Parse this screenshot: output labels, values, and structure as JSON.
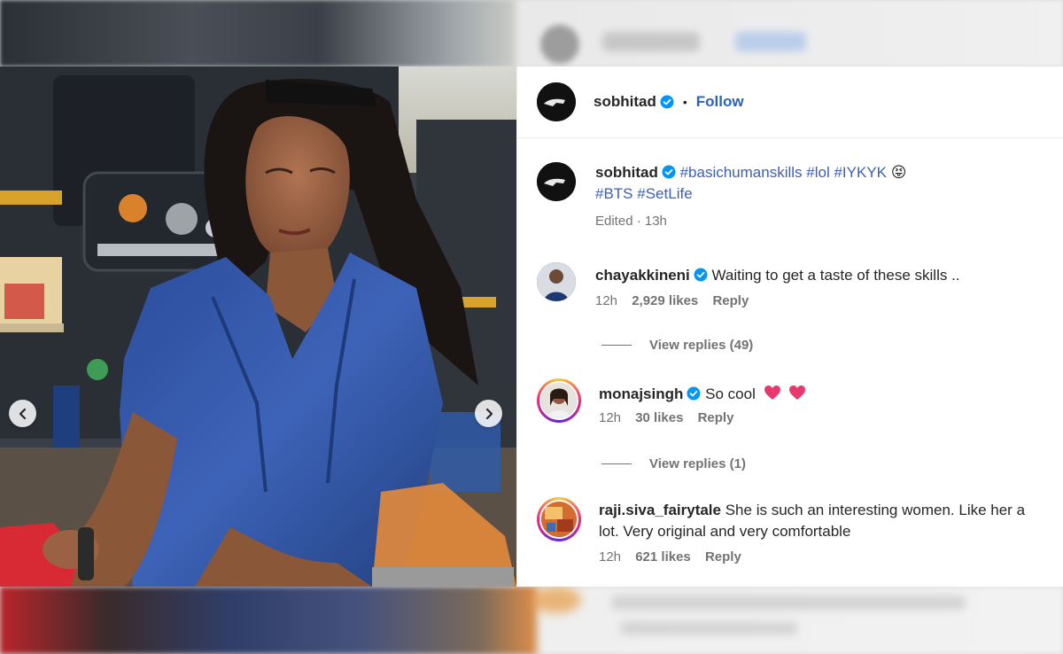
{
  "post": {
    "author": "sobhitad",
    "follow_label": "Follow",
    "separator": "•"
  },
  "caption": {
    "author": "sobhitad",
    "tags_line1": [
      "#basichumanskills",
      "#lol",
      "#IYKYK"
    ],
    "emoji": "😝",
    "tags_line2": [
      "#BTS",
      "#SetLife"
    ],
    "meta": "Edited · 13h"
  },
  "comments": [
    {
      "user": "chayakkineni",
      "text": "Waiting to get a taste of these skills ..",
      "time": "12h",
      "likes": "2,929 likes",
      "reply": "Reply",
      "view_replies": "View replies (49)"
    },
    {
      "user": "monajsingh",
      "text": "So cool",
      "time": "12h",
      "likes": "30 likes",
      "reply": "Reply",
      "view_replies": "View replies (1)"
    },
    {
      "user": "raji.siva_fairytale",
      "text_line1": "She is such an interesting women. Like her a",
      "text_line2": "lot. Very original and very comfortable",
      "time": "12h",
      "likes": "621 likes",
      "reply": "Reply"
    }
  ],
  "icons": {
    "verified": "verified-badge-icon",
    "prev": "chevron-left-icon",
    "next": "chevron-right-icon",
    "heart": "heart-emoji-icon"
  },
  "colors": {
    "link_blue": "#2b63b5",
    "verified_blue": "#0095f6",
    "muted": "#737373"
  }
}
